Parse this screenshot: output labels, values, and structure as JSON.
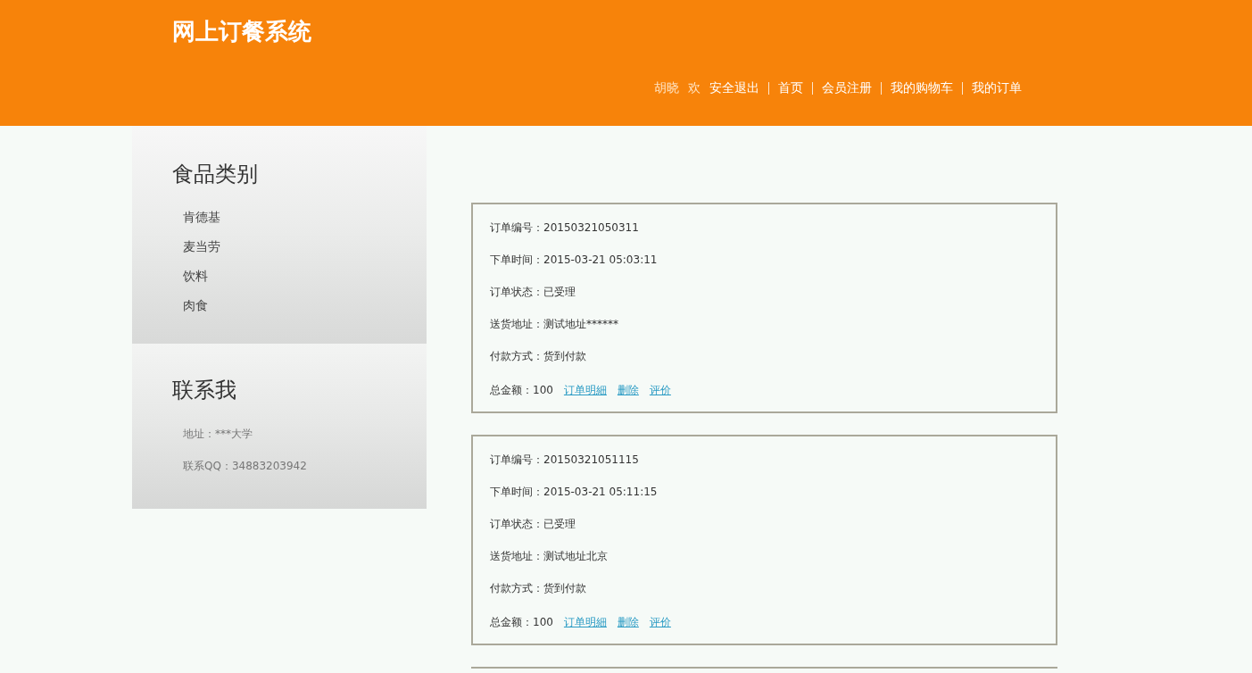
{
  "header": {
    "title": "网上订餐系统",
    "user": "胡晓",
    "greeting": "欢",
    "nav": [
      "安全退出",
      "首页",
      "会员注册",
      "我的购物车",
      "我的订单"
    ]
  },
  "sidebar": {
    "categories": {
      "title": "食品类别",
      "items": [
        "肯德基",
        "麦当劳",
        "饮料",
        "肉食"
      ]
    },
    "contact": {
      "title": "联系我",
      "lines": [
        "地址：***大学",
        "联系QQ：34883203942"
      ]
    }
  },
  "orders": [
    {
      "fields": [
        {
          "label": "订单编号：",
          "value": "20150321050311"
        },
        {
          "label": "下单时间：",
          "value": "2015-03-21 05:03:11"
        },
        {
          "label": "订单状态：",
          "value": "已受理"
        },
        {
          "label": "送货地址：",
          "value": "测试地址******"
        },
        {
          "label": "付款方式：",
          "value": "货到付款"
        }
      ],
      "total": "总金额：100",
      "links": [
        "订单明細",
        "删除",
        "评价"
      ]
    },
    {
      "fields": [
        {
          "label": "订单编号：",
          "value": "20150321051115"
        },
        {
          "label": "下单时间：",
          "value": "2015-03-21 05:11:15"
        },
        {
          "label": "订单状态：",
          "value": "已受理"
        },
        {
          "label": "送货地址：",
          "value": "测试地址北京"
        },
        {
          "label": "付款方式：",
          "value": "货到付款"
        }
      ],
      "total": "总金额：100",
      "links": [
        "订单明細",
        "删除",
        "评价"
      ]
    }
  ]
}
